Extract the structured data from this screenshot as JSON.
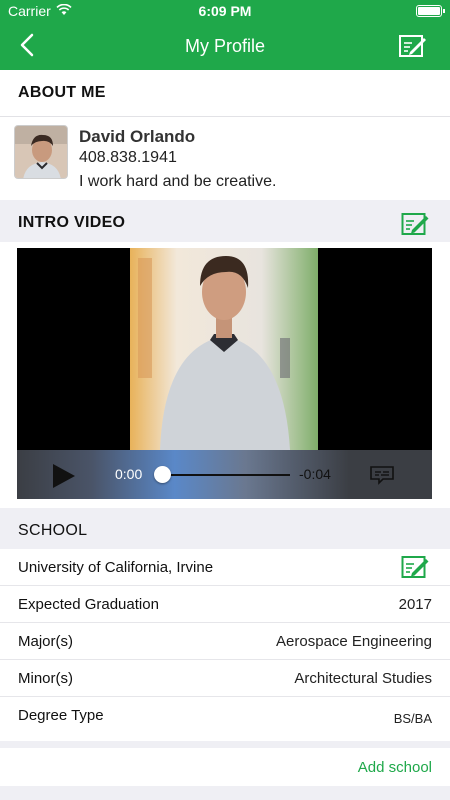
{
  "status_bar": {
    "carrier": "Carrier",
    "time": "6:09 PM"
  },
  "nav": {
    "title": "My Profile",
    "back_icon": "chevron-left-icon",
    "edit_icon": "edit-icon"
  },
  "about": {
    "header": "ABOUT ME",
    "name": "David Orlando",
    "phone": "408.838.1941",
    "bio": "I work hard and be creative."
  },
  "intro_video": {
    "header": "INTRO VIDEO",
    "current_time": "0:00",
    "remaining_time": "-0:04",
    "progress": 0
  },
  "school": {
    "header": "SCHOOL",
    "university": "University of California, Irvine",
    "rows": [
      {
        "label": "Expected Graduation",
        "value": "2017"
      },
      {
        "label": "Major(s)",
        "value": "Aerospace Engineering"
      },
      {
        "label": "Minor(s)",
        "value": "Architectural Studies"
      },
      {
        "label": "Degree Type",
        "value": "BS/BA"
      }
    ],
    "add_label": "Add school"
  },
  "colors": {
    "accent": "#1fa84a",
    "background": "#efeff4"
  }
}
